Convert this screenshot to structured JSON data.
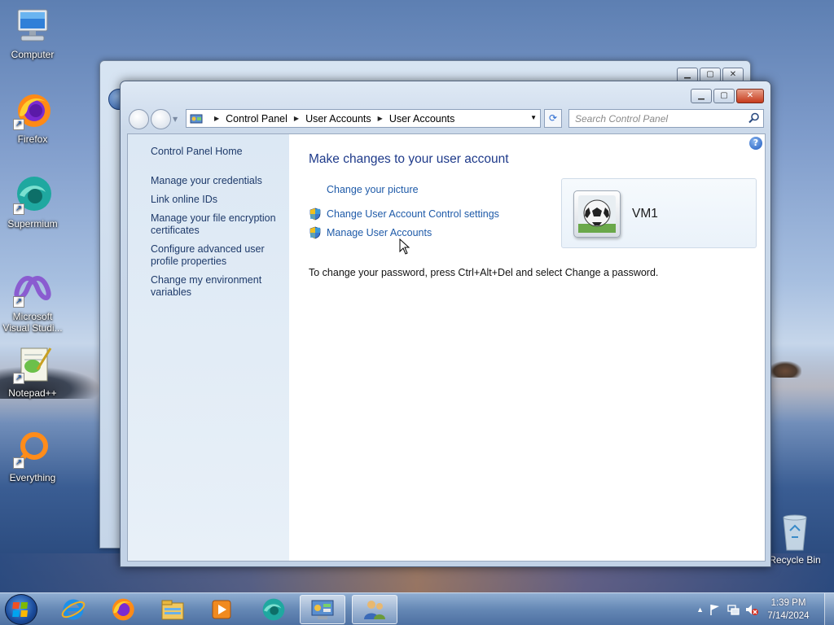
{
  "desktop": {
    "icons": [
      {
        "label": "Computer"
      },
      {
        "label": "Firefox"
      },
      {
        "label": "Supermium"
      },
      {
        "label": "Microsoft Visual Studi..."
      },
      {
        "label": "Notepad++"
      },
      {
        "label": "Everything"
      },
      {
        "label": "Recycle Bin"
      }
    ]
  },
  "window": {
    "breadcrumb": [
      "Control Panel",
      "User Accounts",
      "User Accounts"
    ],
    "search_placeholder": "Search Control Panel",
    "left_links": [
      "Control Panel Home",
      "Manage your credentials",
      "Link online IDs",
      "Manage your file encryption certificates",
      "Configure advanced user profile properties",
      "Change my environment variables"
    ],
    "main": {
      "title": "Make changes to your user account",
      "tasks": [
        {
          "label": "Change your picture",
          "icon": "none"
        },
        {
          "label": "Change User Account Control settings",
          "icon": "uac-shield-icon"
        },
        {
          "label": "Manage User Accounts",
          "icon": "uac-shield-icon"
        }
      ],
      "password_note": "To change your password, press Ctrl+Alt+Del and select Change a password.",
      "user_name": "VM1"
    },
    "help_glyph": "?"
  },
  "taskbar": {
    "time": "1:39 PM",
    "date": "7/14/2024",
    "pinned": [
      "start-orb-icon",
      "internet-explorer-icon",
      "firefox-icon",
      "file-explorer-icon",
      "media-player-icon",
      "supermium-icon",
      "control-panel-icon",
      "user-accounts-icon"
    ]
  }
}
